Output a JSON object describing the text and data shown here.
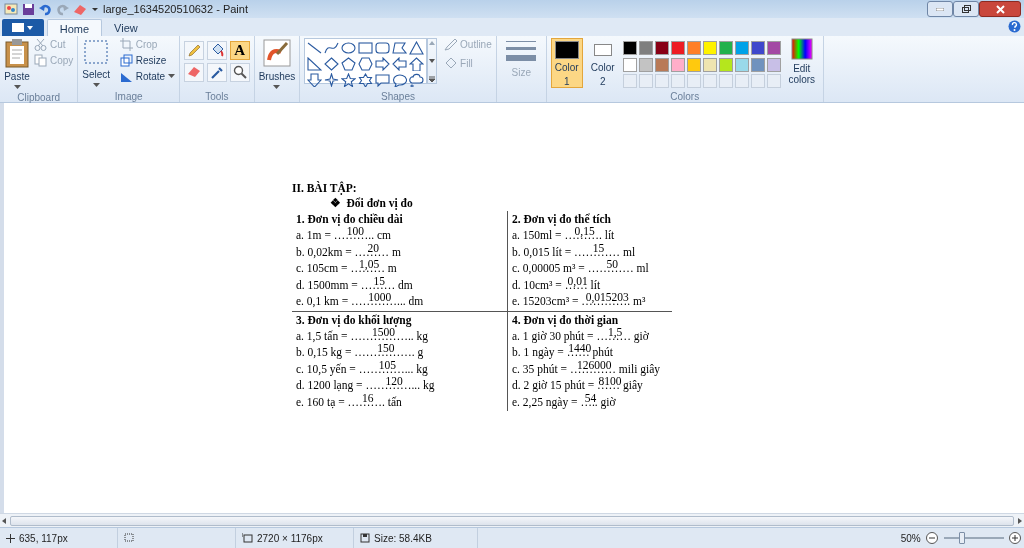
{
  "window": {
    "title": "large_1634520510632 - Paint"
  },
  "tabs": [
    {
      "label": "Home",
      "selected": true
    },
    {
      "label": "View",
      "selected": false
    }
  ],
  "clipboard": {
    "paste": "Paste",
    "cut": {
      "label": "Cut",
      "disabled": true
    },
    "copy": {
      "label": "Copy",
      "disabled": true
    },
    "group": "Clipboard"
  },
  "image": {
    "select": "Select",
    "crop": {
      "label": "Crop",
      "disabled": true
    },
    "resize": {
      "label": "Resize",
      "disabled": false
    },
    "rotate": {
      "label": "Rotate",
      "disabled": false
    },
    "group": "Image"
  },
  "tools": {
    "group": "Tools",
    "items": [
      {
        "kind": "pencil",
        "selected": false
      },
      {
        "kind": "fill",
        "selected": false
      },
      {
        "kind": "text",
        "glyph": "A",
        "selected": true
      },
      {
        "kind": "eraser",
        "selected": false
      },
      {
        "kind": "picker",
        "selected": false
      },
      {
        "kind": "magnifier",
        "selected": false
      }
    ]
  },
  "brushes": "Brushes",
  "shapes": {
    "group": "Shapes",
    "outline": {
      "label": "Outline",
      "disabled": true
    },
    "fill": {
      "label": "Fill",
      "disabled": true
    }
  },
  "size": {
    "label": "Size",
    "disabled": true
  },
  "colors": {
    "group": "Colors",
    "slots": [
      {
        "label": "Color",
        "number": "1",
        "color": "#000000",
        "selected": true
      },
      {
        "label": "Color",
        "number": "2",
        "color": "#ffffff",
        "selected": false
      }
    ],
    "palette": [
      {
        "color": "#000000"
      },
      {
        "color": "#7f7f7f"
      },
      {
        "color": "#880015"
      },
      {
        "color": "#ed1c24"
      },
      {
        "color": "#ff7f27"
      },
      {
        "color": "#fff200"
      },
      {
        "color": "#22b14c"
      },
      {
        "color": "#00a2e8"
      },
      {
        "color": "#3f48cc"
      },
      {
        "color": "#a349a4"
      },
      {
        "color": "#ffffff"
      },
      {
        "color": "#c3c3c3"
      },
      {
        "color": "#b97a57"
      },
      {
        "color": "#ffaec9"
      },
      {
        "color": "#ffc90e"
      },
      {
        "color": "#efe4b0"
      },
      {
        "color": "#b5e61d"
      },
      {
        "color": "#99d9ea"
      },
      {
        "color": "#7092be"
      },
      {
        "color": "#c8bfe7"
      }
    ],
    "edit": "Edit colors"
  },
  "document": {
    "heading": "II. BÀI TẬP:",
    "bullet": "❖",
    "subheading": "Đổi đơn vị đo",
    "sections": [
      {
        "title": "1. Đơn vị đo chiều dài",
        "items": [
          {
            "before": "a. 1m = ",
            "dots": "……….. ",
            "answer": "100",
            "after": "cm"
          },
          {
            "before": "b. 0,02km = ",
            "dots": "……… ",
            "answer": "20",
            "after": "m"
          },
          {
            "before": "c. 105cm = ",
            "dots": "……… ",
            "answer": "1,05",
            "after": "m"
          },
          {
            "before": "d. 1500mm = ",
            "dots": "……… ",
            "answer": "15",
            "after": "dm"
          },
          {
            "before": "e. 0,1 km = ",
            "dots": "…………... ",
            "answer": "1000",
            "after": "dm"
          }
        ]
      },
      {
        "title": "2. Đơn vị đo thể tích",
        "items": [
          {
            "before": "a. 150ml = ",
            "dots": "………. ",
            "answer": "0,15",
            "after": "lít"
          },
          {
            "before": "b. 0,015 lít = ",
            "dots": "………… ",
            "answer": "15",
            "after": "ml"
          },
          {
            "before": "c. 0,00005 m³ = ",
            "dots": "………… ",
            "answer": "50",
            "after": "ml"
          },
          {
            "before": "d. 10cm³ = ",
            "dots": "…… ",
            "answer": "0,01",
            "after": "lít"
          },
          {
            "before": "e. 15203cm³ = ",
            "dots": "…………. ",
            "answer": "0,015203",
            "after": "m³"
          }
        ]
      },
      {
        "title": "3. Đơn vị đo khối lượng",
        "items": [
          {
            "before": "a. 1,5 tấn = ",
            "dots": "…………….. ",
            "answer": "1500",
            "after": "kg"
          },
          {
            "before": "b. 0,15 kg = ",
            "dots": "……………. ",
            "answer": "150",
            "after": "g"
          },
          {
            "before": "c. 10,5 yến = ",
            "dots": "…………... ",
            "answer": "105",
            "after": "kg"
          },
          {
            "before": "d. 1200 lạng = ",
            "dots": "…………... ",
            "answer": "120",
            "after": "kg"
          },
          {
            "before": "e. 160 tạ = ",
            "dots": "………. ",
            "answer": "16",
            "after": "tấn"
          }
        ]
      },
      {
        "title": "4. Đơn vị đo thời gian",
        "items": [
          {
            "before": "a. 1 giờ 30 phút = ",
            "dots": "……… ",
            "answer": "1,5",
            "after": "giờ"
          },
          {
            "before": "b. 1 ngày = ",
            "dots": "…… ",
            "answer": "1440",
            "after": "phút"
          },
          {
            "before": "c. 35 phút = ",
            "dots": "………… ",
            "answer": "126000",
            "after": "mili giây"
          },
          {
            "before": "d. 2 giờ 15 phút = ",
            "dots": "…… ",
            "answer": "8100",
            "after": "giây"
          },
          {
            "before": "e. 2,25 ngày = ",
            "dots": "….. ",
            "answer": "54",
            "after": "giờ"
          }
        ]
      }
    ]
  },
  "status": {
    "position": "635, 117px",
    "dimensions": "2720 × 1176px",
    "size": "Size: 58.4KB",
    "zoom": "50%",
    "zoom_slider": {
      "level": 0.3
    }
  }
}
